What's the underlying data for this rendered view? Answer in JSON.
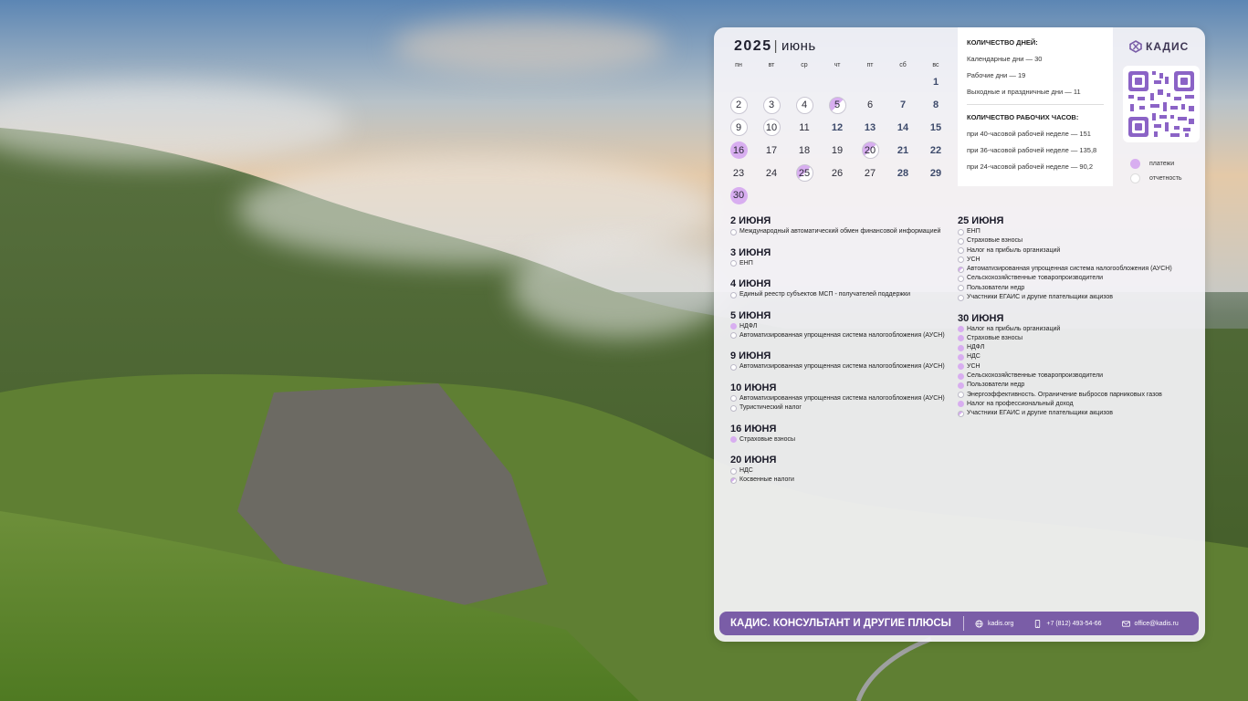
{
  "calendar": {
    "year": "2025",
    "month": "июнь",
    "weekdays": [
      "пн",
      "вт",
      "ср",
      "чт",
      "пт",
      "сб",
      "вс"
    ],
    "days": [
      {
        "d": "",
        "t": ""
      },
      {
        "d": "",
        "t": ""
      },
      {
        "d": "",
        "t": ""
      },
      {
        "d": "",
        "t": ""
      },
      {
        "d": "",
        "t": ""
      },
      {
        "d": "",
        "t": ""
      },
      {
        "d": "1",
        "t": "weekend"
      },
      {
        "d": "2",
        "t": "report"
      },
      {
        "d": "3",
        "t": "report"
      },
      {
        "d": "4",
        "t": "report"
      },
      {
        "d": "5",
        "t": "half"
      },
      {
        "d": "6",
        "t": ""
      },
      {
        "d": "7",
        "t": "weekend"
      },
      {
        "d": "8",
        "t": "weekend"
      },
      {
        "d": "9",
        "t": "report"
      },
      {
        "d": "10",
        "t": "report"
      },
      {
        "d": "11",
        "t": ""
      },
      {
        "d": "12",
        "t": "weekend"
      },
      {
        "d": "13",
        "t": "weekend"
      },
      {
        "d": "14",
        "t": "weekend"
      },
      {
        "d": "15",
        "t": "weekend"
      },
      {
        "d": "16",
        "t": "pay"
      },
      {
        "d": "17",
        "t": ""
      },
      {
        "d": "18",
        "t": ""
      },
      {
        "d": "19",
        "t": ""
      },
      {
        "d": "20",
        "t": "half"
      },
      {
        "d": "21",
        "t": "weekend"
      },
      {
        "d": "22",
        "t": "weekend"
      },
      {
        "d": "23",
        "t": ""
      },
      {
        "d": "24",
        "t": ""
      },
      {
        "d": "25",
        "t": "half"
      },
      {
        "d": "26",
        "t": ""
      },
      {
        "d": "27",
        "t": ""
      },
      {
        "d": "28",
        "t": "weekend"
      },
      {
        "d": "29",
        "t": "weekend"
      },
      {
        "d": "30",
        "t": "pay"
      }
    ]
  },
  "stats": {
    "days_title": "КОЛИЧЕСТВО ДНЕЙ:",
    "calendar_days": "Календарные дни — 30",
    "work_days": "Рабочие дни — 19",
    "holidays": "Выходные и праздничные дни — 11",
    "hours_title": "КОЛИЧЕСТВО РАБОЧИХ ЧАСОВ:",
    "h40": "при 40-часовой рабочей неделе — 151",
    "h36": "при 36-часовой рабочей неделе — 135,8",
    "h24": "при 24-часовой рабочей неделе — 90,2"
  },
  "brand": {
    "logo": "КАДИС"
  },
  "legend": {
    "payments": "платежи",
    "reports": "отчетность",
    "pay_color": "#d8aef0"
  },
  "events_left": [
    {
      "date": "2 ИЮНЯ",
      "items": [
        {
          "t": "Международный автоматический обмен финансовой информацией",
          "k": "report"
        }
      ]
    },
    {
      "date": "3 ИЮНЯ",
      "items": [
        {
          "t": "ЕНП",
          "k": "report"
        }
      ]
    },
    {
      "date": "4 ИЮНЯ",
      "items": [
        {
          "t": "Единый реестр субъектов МСП - получателей поддержки",
          "k": "report"
        }
      ]
    },
    {
      "date": "5 ИЮНЯ",
      "items": [
        {
          "t": "НДФЛ",
          "k": "pay"
        },
        {
          "t": "Автоматизированная упрощенная система налогообложения (АУСН)",
          "k": "report"
        }
      ]
    },
    {
      "date": "9 ИЮНЯ",
      "items": [
        {
          "t": "Автоматизированная упрощенная система налогообложения (АУСН)",
          "k": "report"
        }
      ]
    },
    {
      "date": "10 ИЮНЯ",
      "items": [
        {
          "t": "Автоматизированная упрощенная система налогообложения (АУСН)",
          "k": "report"
        },
        {
          "t": "Туристический налог",
          "k": "report"
        }
      ]
    },
    {
      "date": "16 ИЮНЯ",
      "items": [
        {
          "t": "Страховые взносы",
          "k": "pay"
        }
      ]
    },
    {
      "date": "20 ИЮНЯ",
      "items": [
        {
          "t": "НДС",
          "k": "report"
        },
        {
          "t": "Косвенные налоги",
          "k": "half"
        }
      ]
    }
  ],
  "events_right": [
    {
      "date": "25 ИЮНЯ",
      "items": [
        {
          "t": "ЕНП",
          "k": "report"
        },
        {
          "t": "Страховые взносы",
          "k": "report"
        },
        {
          "t": "Налог на прибыль организаций",
          "k": "report"
        },
        {
          "t": "УСН",
          "k": "report"
        },
        {
          "t": "Автоматизированная упрощенная система налогообложения (АУСН)",
          "k": "half"
        },
        {
          "t": "Сельскохозяйственные товаропроизводители",
          "k": "report"
        },
        {
          "t": "Пользователи недр",
          "k": "report"
        },
        {
          "t": "Участники ЕГАИС и другие плательщики акцизов",
          "k": "report"
        }
      ]
    },
    {
      "date": "30 ИЮНЯ",
      "items": [
        {
          "t": "Налог на прибыль организаций",
          "k": "pay"
        },
        {
          "t": "Страховые взносы",
          "k": "pay"
        },
        {
          "t": "НДФЛ",
          "k": "pay"
        },
        {
          "t": "НДС",
          "k": "pay"
        },
        {
          "t": "УСН",
          "k": "pay"
        },
        {
          "t": "Сельскохозяйственные товаропроизводители",
          "k": "pay"
        },
        {
          "t": "Пользователи недр",
          "k": "pay"
        },
        {
          "t": "Энергоэффективность. Ограничение выбросов парниковых газов",
          "k": "report"
        },
        {
          "t": "Налог на профессиональный доход",
          "k": "pay"
        },
        {
          "t": "Участники ЕГАИС и другие плательщики акцизов",
          "k": "half"
        }
      ]
    }
  ],
  "footer": {
    "brand": "КАДИС. КОНСУЛЬТАНТ И ДРУГИЕ ПЛЮСЫ",
    "site": "kadis.org",
    "phone": "+7 (812) 493-54-66",
    "email": "office@kadis.ru",
    "bar_color": "#7a5da7"
  }
}
